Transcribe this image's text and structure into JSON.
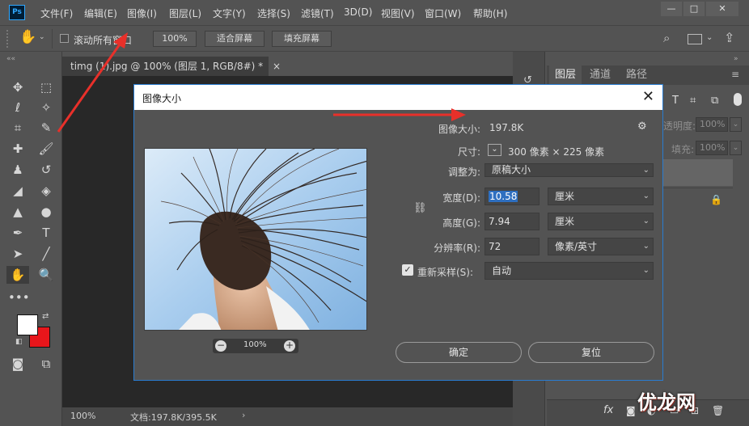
{
  "app": {
    "logo": "Ps",
    "menu": [
      "文件(F)",
      "编辑(E)",
      "图像(I)",
      "图层(L)",
      "文字(Y)",
      "选择(S)",
      "滤镜(T)",
      "3D(D)",
      "视图(V)",
      "窗口(W)",
      "帮助(H)"
    ],
    "window_controls": [
      "—",
      "□",
      "✕"
    ]
  },
  "options_bar": {
    "scroll_all_label": "滚动所有窗口",
    "zoom_value": "100%",
    "fit_screen": "适合屏幕",
    "fill_screen": "填充屏幕"
  },
  "document": {
    "tab_title": "timg (1).jpg @ 100% (图层 1, RGB/8#) *",
    "tab_close": "×",
    "status_zoom": "100%",
    "status_doc": "文档:197.8K/395.5K"
  },
  "right_panel": {
    "tabs": [
      "图层",
      "通道",
      "路径"
    ],
    "opacity_label": "透明度:",
    "opacity_value": "100%",
    "fill_label": "填充:",
    "fill_value": "100%"
  },
  "dialog": {
    "title": "图像大小",
    "close": "✕",
    "preview_zoom": "100%",
    "image_size_label": "图像大小:",
    "image_size_value": "197.8K",
    "dimensions_label": "尺寸:",
    "dimensions_value": "300 像素 × 225 像素",
    "fit_to_label": "调整为:",
    "fit_to_value": "原稿大小",
    "width_label": "宽度(D):",
    "width_value": "10.58",
    "width_unit": "厘米",
    "height_label": "高度(G):",
    "height_value": "7.94",
    "height_unit": "厘米",
    "resolution_label": "分辨率(R):",
    "resolution_value": "72",
    "resolution_unit": "像素/英寸",
    "resample_label": "重新采样(S):",
    "resample_checked": true,
    "resample_value": "自动",
    "ok_button": "确定",
    "reset_button": "复位"
  },
  "watermark": "优龙网",
  "colors": {
    "foreground": "#ffffff",
    "background": "#e8161b",
    "accent": "#2a7cd0",
    "arrow": "#e8302a"
  }
}
